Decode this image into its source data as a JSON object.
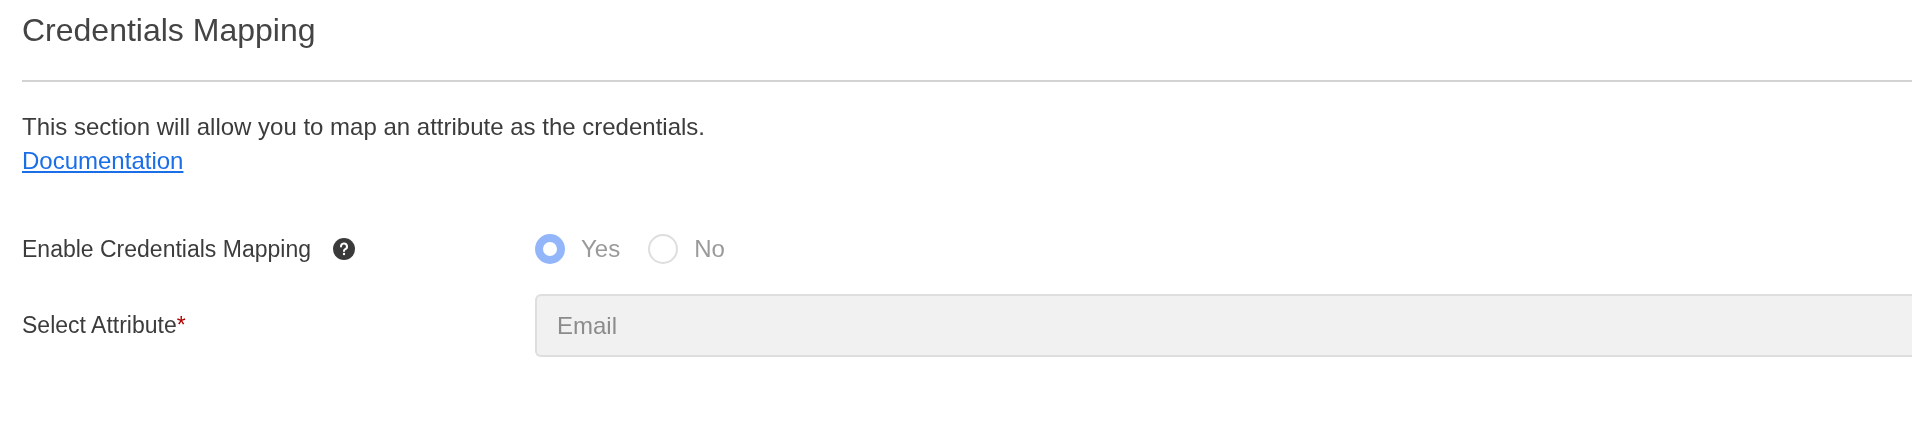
{
  "title": "Credentials Mapping",
  "description": "This section will allow you to map an attribute as the credentials.",
  "link": "Documentation",
  "fields": [
    {
      "kind": "radio",
      "label": "Enable Credentials Mapping",
      "help": true,
      "disabled": true,
      "options": [
        {
          "label": "Yes",
          "selected": true
        },
        {
          "label": "No",
          "selected": false
        }
      ]
    },
    {
      "kind": "select",
      "label": "Select Attribute",
      "required_mark": "*",
      "help": false,
      "disabled": true,
      "value": "Email"
    }
  ]
}
